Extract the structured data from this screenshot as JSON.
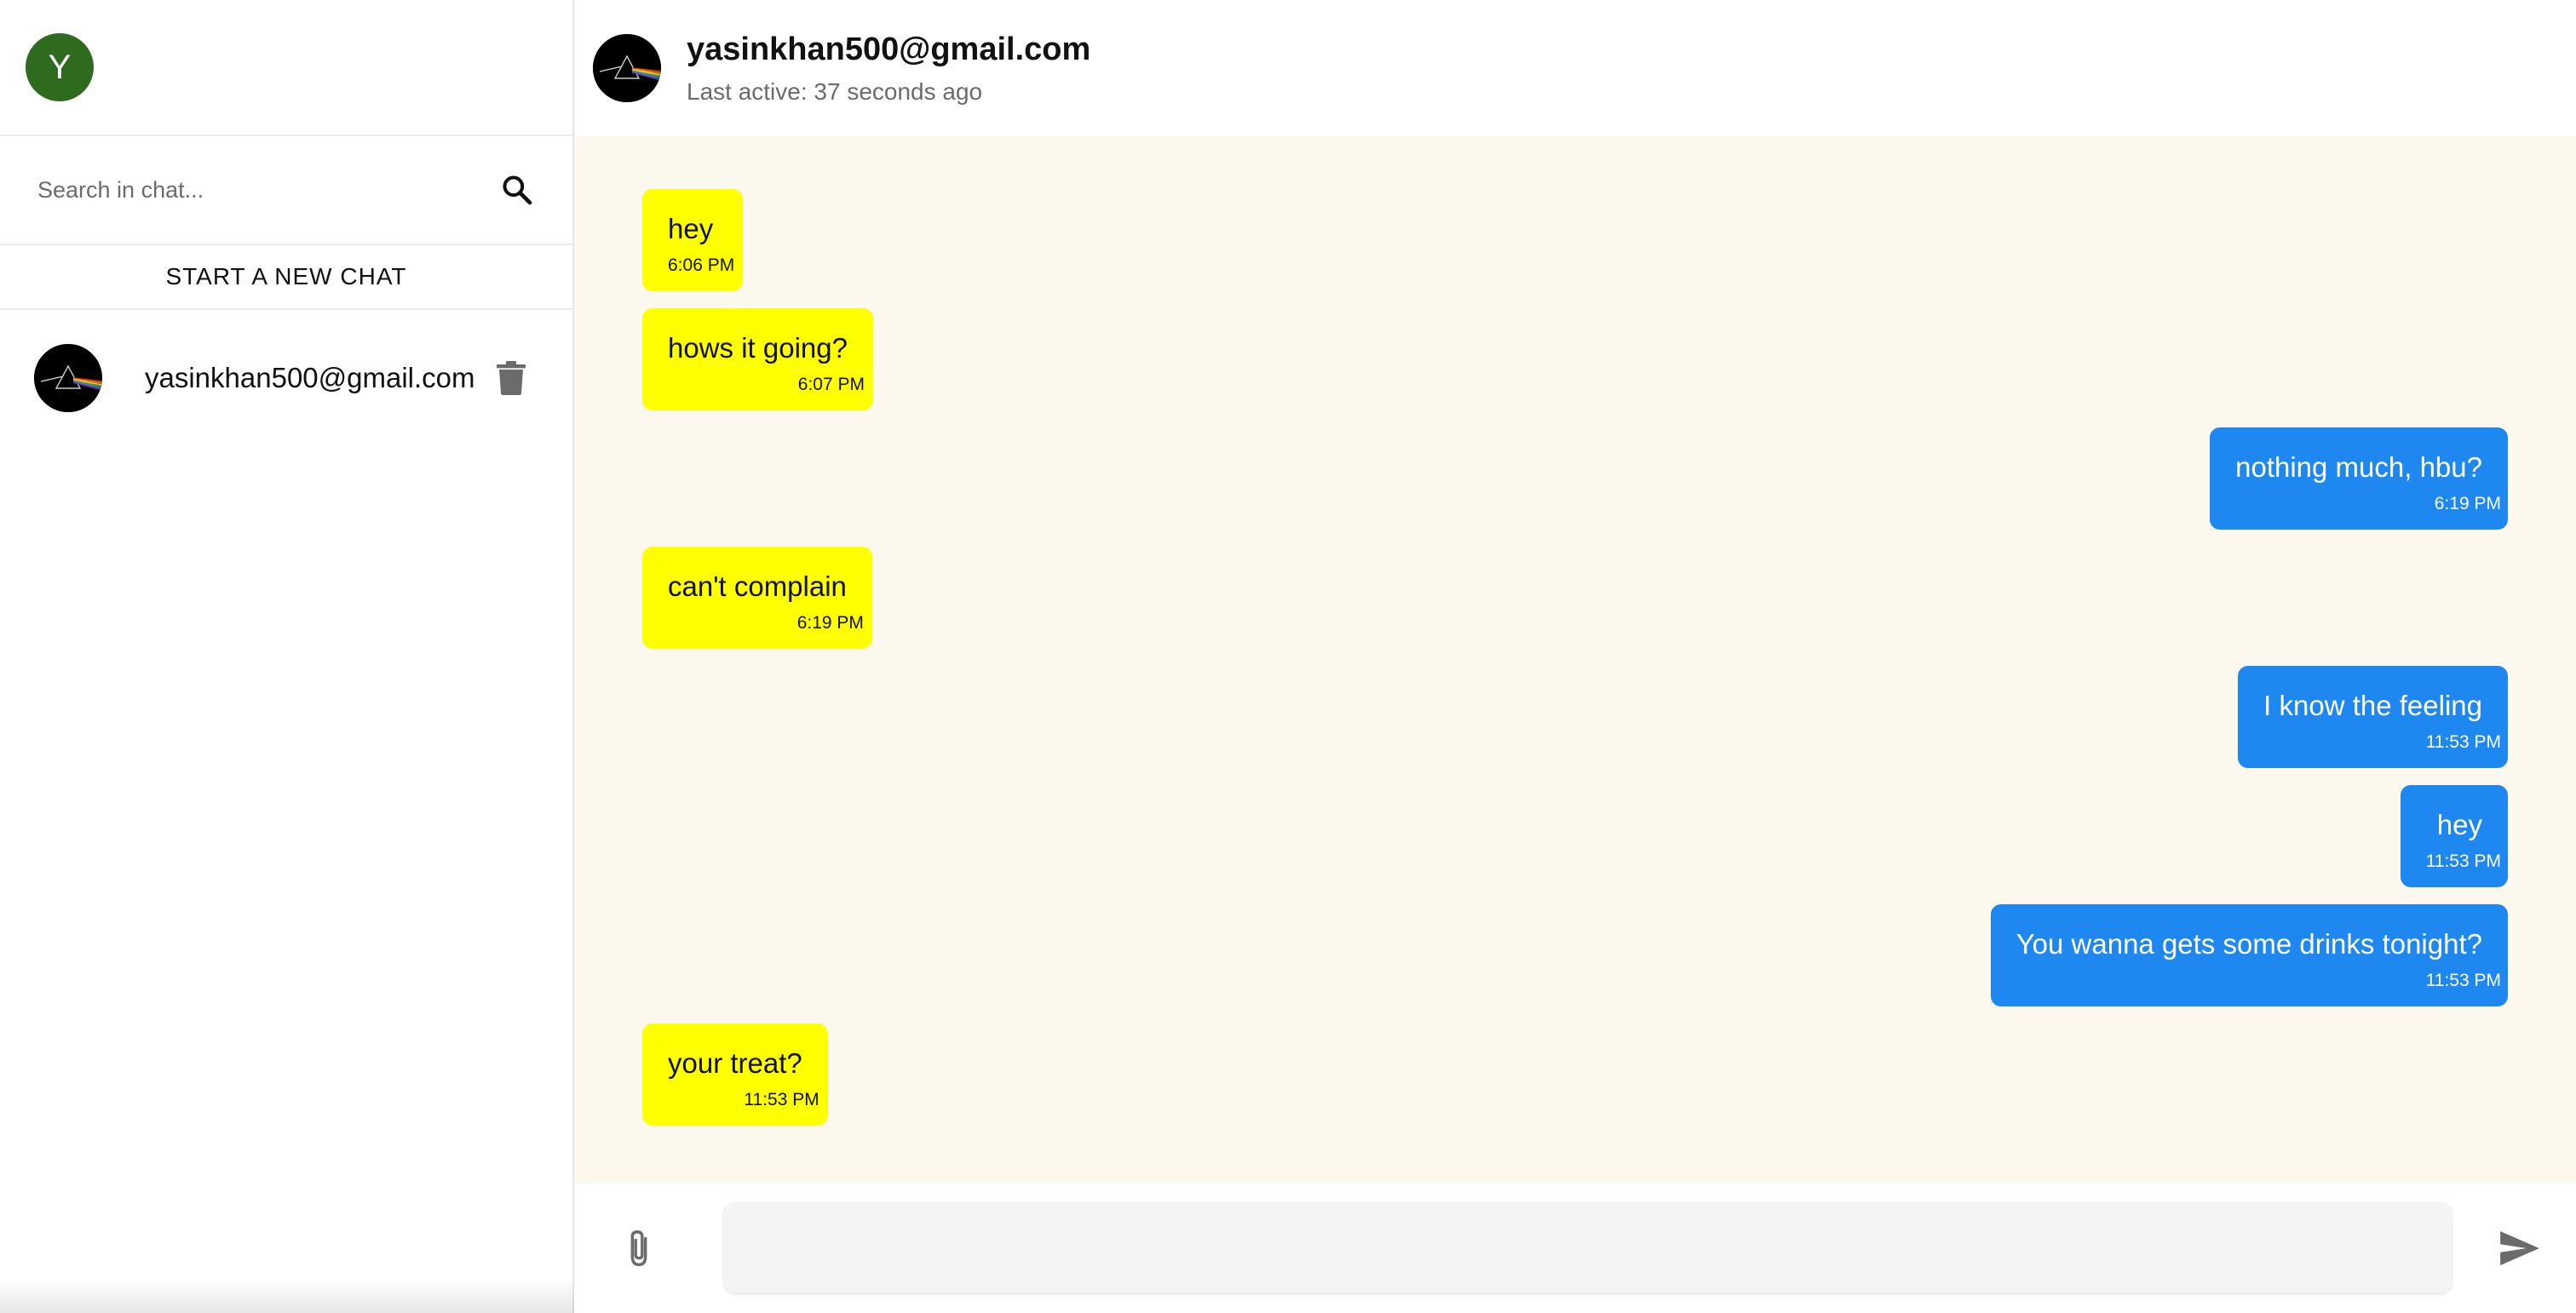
{
  "user": {
    "avatar_initial": "Y",
    "avatar_color": "#2e6b1f"
  },
  "sidebar": {
    "search_placeholder": "Search in chat...",
    "new_chat_label": "START A NEW CHAT",
    "chats": [
      {
        "name": "yasinkhan500@gmail.com",
        "avatar_icon": "prism-album-icon"
      }
    ]
  },
  "chat": {
    "title": "yasinkhan500@gmail.com",
    "subtitle": "Last active: 37 seconds ago",
    "messages": [
      {
        "direction": "in",
        "text": "hey",
        "time": "6:06 PM"
      },
      {
        "direction": "in",
        "text": "hows it going?",
        "time": "6:07 PM"
      },
      {
        "direction": "out",
        "text": "nothing much, hbu?",
        "time": "6:19 PM"
      },
      {
        "direction": "in",
        "text": "can't complain",
        "time": "6:19 PM"
      },
      {
        "direction": "out",
        "text": "I know the feeling",
        "time": "11:53 PM"
      },
      {
        "direction": "out",
        "text": "hey",
        "time": "11:53 PM"
      },
      {
        "direction": "out",
        "text": "You wanna gets some drinks tonight?",
        "time": "11:53 PM"
      },
      {
        "direction": "in",
        "text": "your treat?",
        "time": "11:53 PM"
      }
    ]
  },
  "composer": {
    "value": ""
  },
  "colors": {
    "incoming_bubble": "#ffff00",
    "outgoing_bubble": "#1e88f0",
    "chat_background": "#fcf8ee"
  }
}
